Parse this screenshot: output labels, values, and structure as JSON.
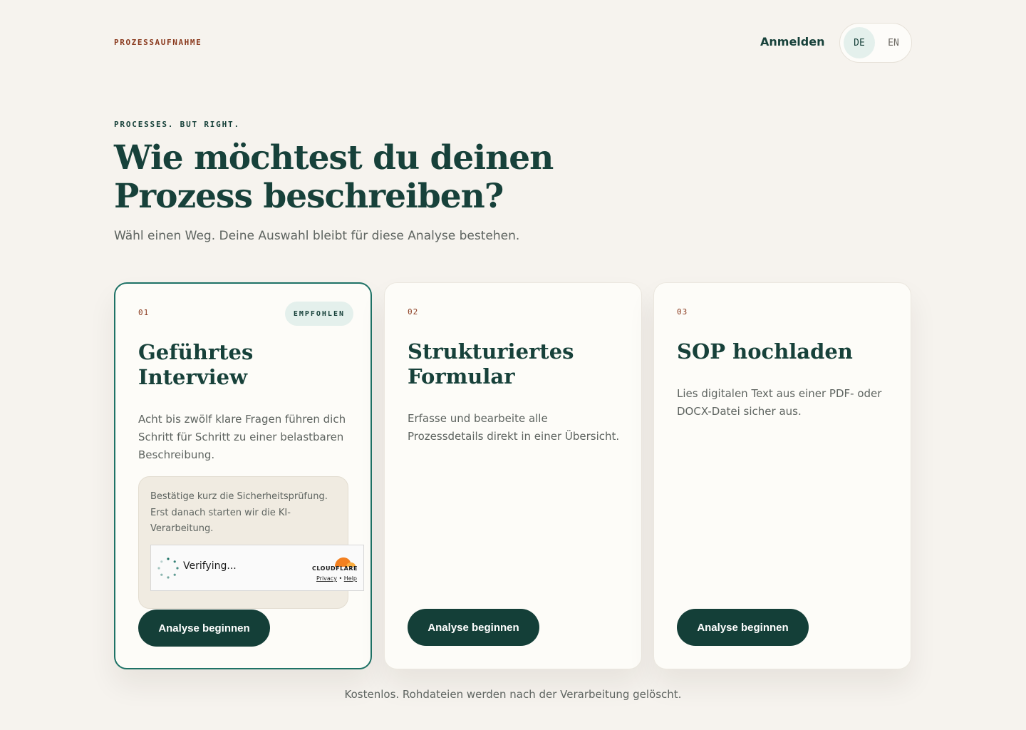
{
  "header": {
    "brand": "PROZESSAUFNAHME",
    "login_label": "Anmelden",
    "languages": [
      "DE",
      "EN"
    ],
    "active_language": "DE"
  },
  "hero": {
    "eyebrow": "PROCESSES. BUT RIGHT.",
    "title_line1": "Wie möchtest du deinen",
    "title_line2": "Prozess beschreiben?",
    "subtitle": "Wähl einen Weg. Deine Auswahl bleibt für diese Analyse bestehen."
  },
  "cards": [
    {
      "number": "01",
      "badge": "EMPFOHLEN",
      "title_line1": "Geführtes",
      "title_line2": "Interview",
      "description": "Acht bis zwölf klare Fragen führen dich Schritt für Schritt zu einer belastbaren Beschreibung.",
      "security_message": "Bestätige kurz die Sicherheitsprüfung. Erst danach starten wir die KI-Verarbeitung.",
      "cta": "Analyse beginnen",
      "selected": true
    },
    {
      "number": "02",
      "title_line1": "Strukturiertes",
      "title_line2": "Formular",
      "description": "Erfasse und bearbeite alle Prozessdetails direkt in einer Übersicht.",
      "cta": "Analyse beginnen"
    },
    {
      "number": "03",
      "title_line1": "SOP hochladen",
      "title_line2": "",
      "description": "Lies digitalen Text aus einer PDF- oder DOCX-Datei sicher aus.",
      "cta": "Analyse beginnen"
    }
  ],
  "captcha": {
    "status": "Verifying...",
    "provider": "CLOUDFLARE",
    "privacy": "Privacy",
    "separator": "•",
    "help": "Help"
  },
  "footer": {
    "note": "Kostenlos. Rohdateien werden nach der Verarbeitung gelöscht."
  },
  "colors": {
    "background": "#f6f3ee",
    "primary": "#143f38",
    "accent_border": "#1e7266",
    "number_color": "#8a3a1e",
    "badge_bg": "#e4f0ec",
    "cloudflare_orange": "#f38020"
  }
}
